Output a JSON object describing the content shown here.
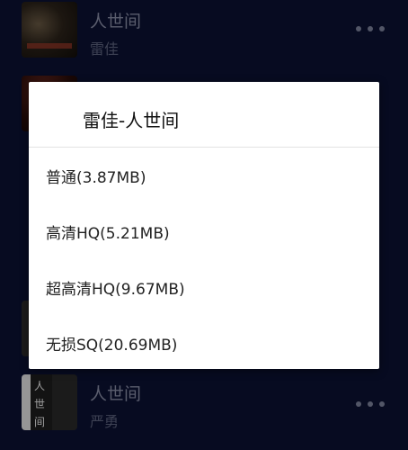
{
  "songs": [
    {
      "title": "人世间",
      "artist": "雷佳"
    },
    {
      "title": "人世间",
      "artist": "严勇"
    }
  ],
  "dialog": {
    "title": "雷佳-人世间",
    "options": [
      {
        "label": "普通(3.87MB)"
      },
      {
        "label": "高清HQ(5.21MB)"
      },
      {
        "label": "超高清HQ(9.67MB)"
      },
      {
        "label": "无损SQ(20.69MB)"
      }
    ]
  },
  "icons": {
    "more": "more-horizontal-icon"
  },
  "colors": {
    "background": "#0b1133",
    "dialog_background": "#ffffff",
    "text_primary": "#222222"
  }
}
